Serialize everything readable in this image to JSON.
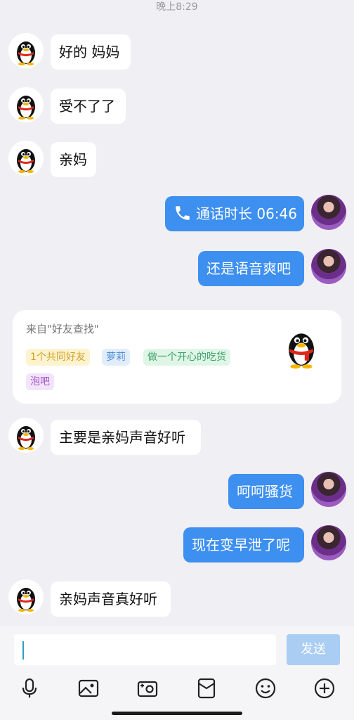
{
  "header": {
    "timestamp": "晚上8:29"
  },
  "messages": [
    {
      "side": "in",
      "text": "好的 妈妈"
    },
    {
      "side": "in",
      "text": "受不了了"
    },
    {
      "side": "in",
      "text": "亲妈"
    },
    {
      "side": "out",
      "text": "通话时长 06:46",
      "icon": "phone-icon"
    },
    {
      "side": "out",
      "text": "还是语音爽吧"
    },
    {
      "side": "in",
      "text": "主要是亲妈声音好听"
    },
    {
      "side": "out",
      "text": "呵呵骚货"
    },
    {
      "side": "out",
      "text": "现在变早泄了呢"
    },
    {
      "side": "in",
      "text": "亲妈声音真好听"
    }
  ],
  "card": {
    "source": "来自\"好友查找\"",
    "tags": [
      "1个共同好友",
      "萝莉",
      "做一个开心的吃货",
      "泡吧"
    ]
  },
  "input_bar": {
    "placeholder": "",
    "send_label": "发送",
    "tools": [
      "microphone-icon",
      "image-icon",
      "camera-icon",
      "red-packet-icon",
      "emoji-icon",
      "plus-icon"
    ]
  },
  "colors": {
    "outgoing_bubble": "#3d8ff0",
    "send_button_disabled": "#a9cdf3",
    "background": "#f0eff4"
  }
}
